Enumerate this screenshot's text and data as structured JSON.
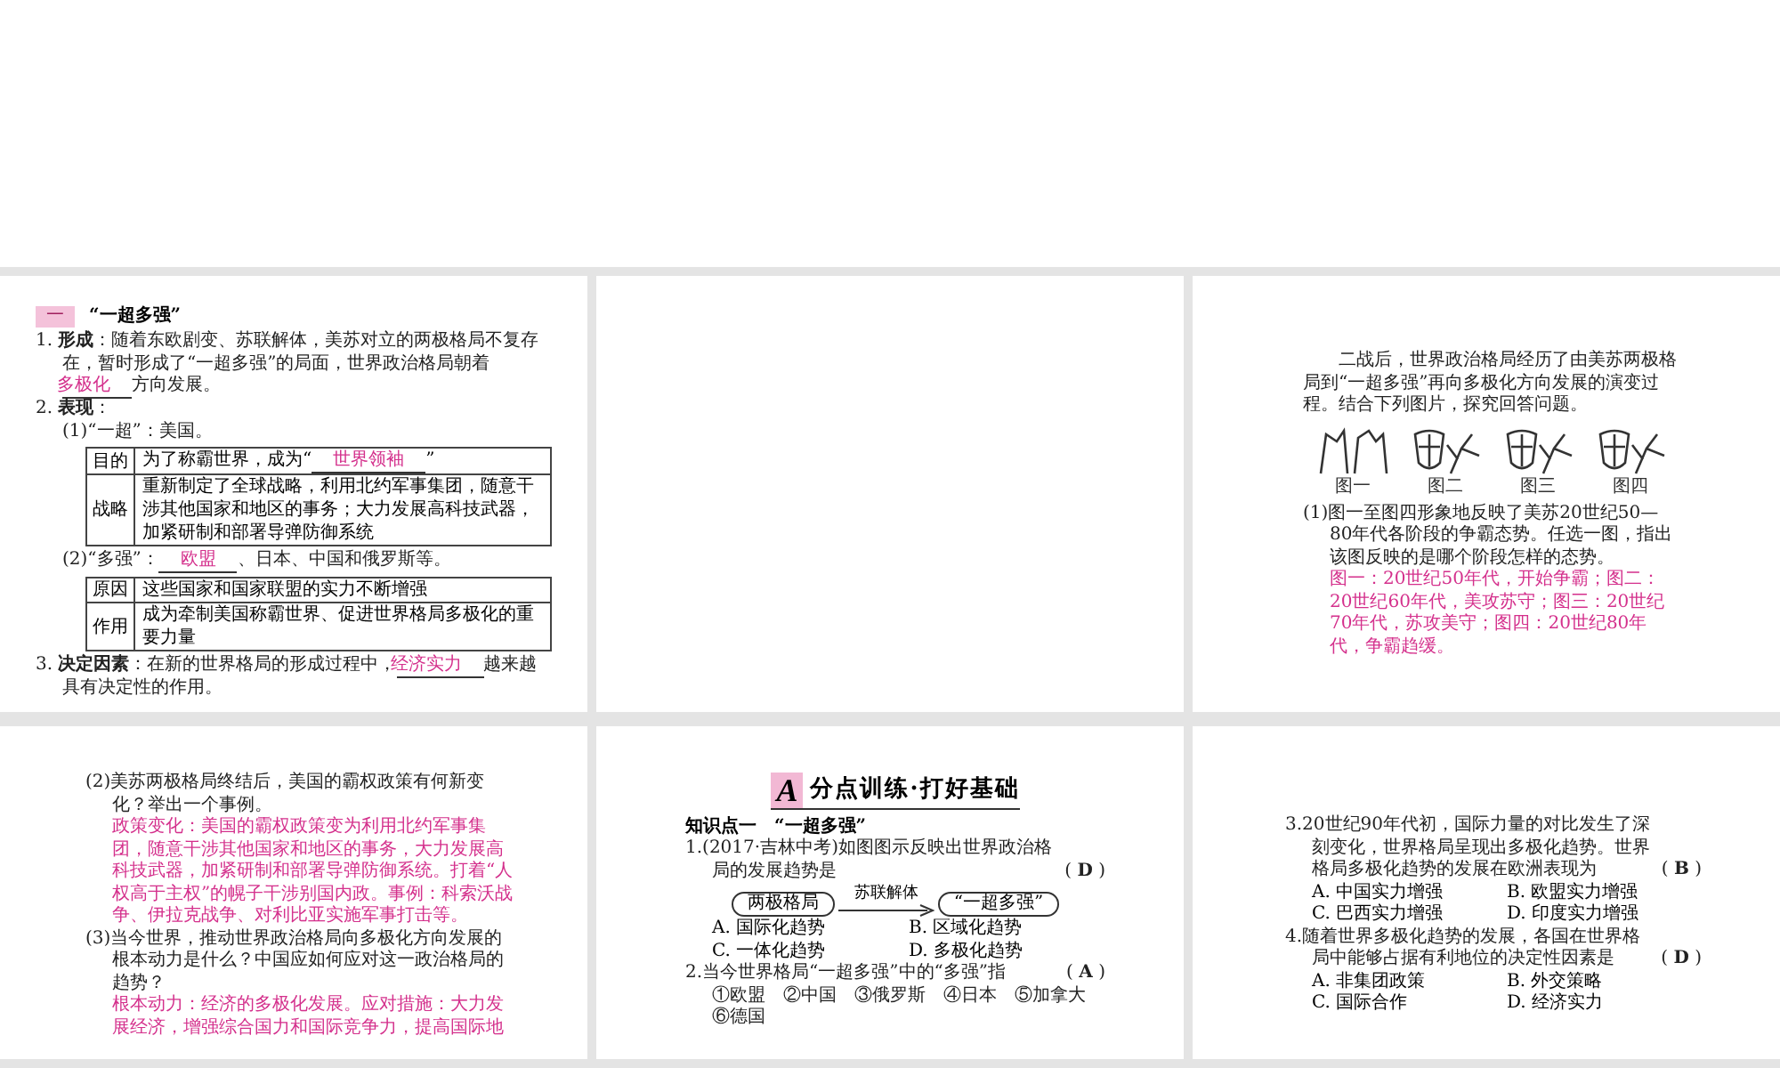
{
  "pages": [
    {
      "kind": "content",
      "blocks": [
        {
          "kind": "section_heading",
          "badge": "一",
          "text": "“一超多强”"
        },
        {
          "kind": "item",
          "segments": [
            {
              "text": "1. **形成**：随着东欧剧变、苏联解体，美苏对立的两极格局不复存在，暂时形成了“一超多强”的局面，世界政治格局朝着"
            },
            {
              "text": "多极化",
              "answer": true
            },
            {
              "text": "方向发展。"
            }
          ]
        },
        {
          "kind": "label",
          "segments": [
            {
              "text": "2. **表现**："
            }
          ]
        },
        {
          "kind": "sub",
          "segments": [
            {
              "text": "(1)“一超”：美国。"
            }
          ]
        },
        {
          "kind": "table",
          "rows": [
            {
              "head": "目的",
              "segments": [
                {
                  "text": "为了称霸世界，成为“"
                },
                {
                  "text": "世界领袖",
                  "answer": true
                },
                {
                  "text": "”"
                }
              ]
            },
            {
              "head": "战略",
              "segments": [
                {
                  "text": "重新制定了全球战略，利用北约军事集团，随意干涉其他国家和地区的事务；大力发展高科技武器，加紧研制和部署导弹防御系统"
                }
              ]
            }
          ]
        },
        {
          "kind": "sub",
          "segments": [
            {
              "text": "(2)“多强”："
            },
            {
              "text": "欧盟",
              "answer": true
            },
            {
              "text": "、日本、中国和俄罗斯等。"
            }
          ]
        },
        {
          "kind": "table",
          "rows": [
            {
              "head": "原因",
              "segments": [
                {
                  "text": "这些国家和国家联盟的实力不断增强"
                }
              ]
            },
            {
              "head": "作用",
              "segments": [
                {
                  "text": "成为牵制美国称霸世界、促进世界格局多极化的重要力量"
                }
              ]
            }
          ]
        },
        {
          "kind": "item",
          "segments": [
            {
              "text": "3. **决定因素**：在新的世界格局的形成过程中，"
            },
            {
              "text": "经济实力",
              "answer": true
            },
            {
              "text": "越来越具有决定性的作用。"
            }
          ]
        }
      ]
    },
    {
      "kind": "blank"
    },
    {
      "kind": "content",
      "blocks": [
        {
          "kind": "intro",
          "segments": [
            {
              "text": "二战后，世界政治格局经历了由美苏两极格局到“一超多强”再向多极化方向发展的演变过程。结合下列图片，探究回答问题。"
            }
          ]
        },
        {
          "kind": "figure",
          "captions": [
            "图一",
            "图二",
            "图三",
            "图四"
          ]
        },
        {
          "kind": "item",
          "segments": [
            {
              "text": "(1)图一至图四形象地反映了美苏20世纪50—80年代各阶段的争霸态势。任选一图，指出该图反映的是哪个阶段怎样的态势。"
            }
          ]
        },
        {
          "kind": "answer",
          "text": "图一：20世纪50年代，开始争霸；图二：20世纪60年代，美攻苏守；图三：20世纪70年代，苏攻美守；图四：20世纪80年代，争霸趋缓。"
        }
      ]
    },
    {
      "kind": "content",
      "blocks": [
        {
          "kind": "item",
          "segments": [
            {
              "text": "(2)美苏两极格局终结后，美国的霸权政策有何新变化？举出一个事例。"
            }
          ]
        },
        {
          "kind": "answer",
          "text": "政策变化：美国的霸权政策变为利用北约军事集团，随意干涉其他国家和地区的事务，大力发展高科技武器，加紧研制和部署导弹防御系统。打着“人权高于主权”的幌子干涉别国内政。事例：科索沃战争、伊拉克战争、对利比亚实施军事打击等。"
        },
        {
          "kind": "item",
          "segments": [
            {
              "text": "(3)当今世界，推动世界政治格局向多极化方向发展的根本动力是什么？中国应如何应对这一政治格局的趋势？"
            }
          ]
        },
        {
          "kind": "answer",
          "text": "根本动力：经济的多极化发展。应对措施：大力发展经济，增强综合国力和国际竞争力，提高国际地"
        }
      ]
    },
    {
      "kind": "content",
      "blocks": [
        {
          "kind": "banner",
          "letter": "A",
          "text": "分点训练·打好基础"
        },
        {
          "kind": "subheading",
          "text": "知识点一　“一超多强”"
        },
        {
          "kind": "item",
          "choice": "( **D** )",
          "segments": [
            {
              "text": "1.(2017·吉林中考)如图图示反映出世界政治格局的发展趋势是"
            }
          ]
        },
        {
          "kind": "diagram",
          "from": "两极格局",
          "label": "苏联解体",
          "to": "“一超多强”"
        },
        {
          "kind": "options",
          "items": [
            "A. 国际化趋势",
            "B. 区域化趋势",
            "C. 一体化趋势",
            "D. 多极化趋势"
          ]
        },
        {
          "kind": "item",
          "choice": "( **A** )",
          "segments": [
            {
              "text": "2.当今世界格局“一超多强”中的“多强”指"
            }
          ]
        },
        {
          "kind": "sub",
          "segments": [
            {
              "text": "①欧盟　②中国　③俄罗斯　④日本　⑤加拿大　⑥德国"
            }
          ]
        }
      ]
    },
    {
      "kind": "content",
      "blocks": [
        {
          "kind": "item",
          "choice": "( **B** )",
          "segments": [
            {
              "text": "3.20世纪90年代初，国际力量的对比发生了深刻变化，世界格局呈现出多极化趋势。世界格局多极化趋势的发展在欧洲表现为"
            }
          ]
        },
        {
          "kind": "options",
          "items": [
            "A. 中国实力增强",
            "B. 欧盟实力增强",
            "C. 巴西实力增强",
            "D. 印度实力增强"
          ]
        },
        {
          "kind": "item",
          "choice": "( **D** )",
          "segments": [
            {
              "text": "4.随着世界多极化趋势的发展，各国在世界格局中能够占据有利地位的决定性因素是"
            }
          ]
        },
        {
          "kind": "options",
          "items": [
            "A. 非集团政策",
            "B. 外交策略",
            "C. 国际合作",
            "D. 经济实力"
          ]
        }
      ]
    }
  ]
}
